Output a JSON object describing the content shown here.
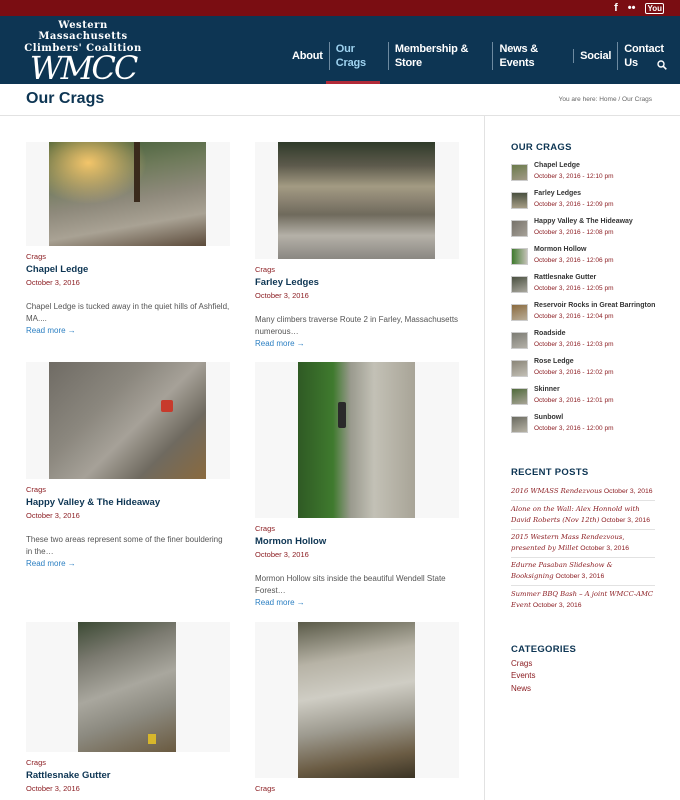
{
  "social": {
    "facebook": "f",
    "flickr": "••",
    "youtube": "You"
  },
  "logo": {
    "line1": "Western Massachusetts",
    "line2": "Climbers' Coalition",
    "wordmark": "WMCC"
  },
  "nav": {
    "items": [
      {
        "label": "About"
      },
      {
        "label": "Our Crags",
        "active": true
      },
      {
        "label": "Membership & Store"
      },
      {
        "label": "News & Events"
      },
      {
        "label": "Social"
      },
      {
        "label": "Contact Us"
      }
    ]
  },
  "page": {
    "title": "Our Crags",
    "breadcrumb": {
      "prefix": "You are here:",
      "home": "Home",
      "sep": "/",
      "current": "Our Crags"
    }
  },
  "posts": [
    {
      "category": "Crags",
      "title": "Chapel Ledge",
      "date": "October 3, 2016",
      "excerpt": "Chapel Ledge is tucked away in the quiet hills of Ashfield, MA....",
      "more": "Read more →"
    },
    {
      "category": "Crags",
      "title": "Farley Ledges",
      "date": "October 3, 2016",
      "excerpt": "Many climbers traverse Route 2 in Farley, Massachusetts numerous…",
      "more": "Read more →"
    },
    {
      "category": "Crags",
      "title": "Happy Valley & The Hideaway",
      "date": "October 3, 2016",
      "excerpt": "These two areas represent some of the finer bouldering in the…",
      "more": "Read more →"
    },
    {
      "category": "Crags",
      "title": "Mormon Hollow",
      "date": "October 3, 2016",
      "excerpt": "Mormon Hollow sits inside the beautiful Wendell State Forest…",
      "more": "Read more →"
    },
    {
      "category": "Crags",
      "title": "Rattlesnake Gutter",
      "date": "October 3, 2016"
    },
    {
      "category": "Crags"
    }
  ],
  "sidebar": {
    "crags_heading": "OUR CRAGS",
    "crags": [
      {
        "name": "Chapel Ledge",
        "date": "October 3, 2016 - 12:10 pm"
      },
      {
        "name": "Farley Ledges",
        "date": "October 3, 2016 - 12:09 pm"
      },
      {
        "name": "Happy Valley & The Hideaway",
        "date": "October 3, 2016 - 12:08 pm"
      },
      {
        "name": "Mormon Hollow",
        "date": "October 3, 2016 - 12:06 pm"
      },
      {
        "name": "Rattlesnake Gutter",
        "date": "October 3, 2016 - 12:05 pm"
      },
      {
        "name": "Reservoir Rocks in Great Barrington",
        "date": "October 3, 2016 - 12:04 pm"
      },
      {
        "name": "Roadside",
        "date": "October 3, 2016 - 12:03 pm"
      },
      {
        "name": "Rose Ledge",
        "date": "October 3, 2016 - 12:02 pm"
      },
      {
        "name": "Skinner",
        "date": "October 3, 2016 - 12:01 pm"
      },
      {
        "name": "Sunbowl",
        "date": "October 3, 2016 - 12:00 pm"
      }
    ],
    "recent_heading": "RECENT POSTS",
    "recent": [
      {
        "title": "2016 WMASS Rendezvous",
        "date": "October 3, 2016"
      },
      {
        "title": "Alone on the Wall: Alex Honnold with David Roberts (Nov 12th)",
        "date": "October 3, 2016"
      },
      {
        "title": "2015 Western Mass Rendezvous, presented by Millet",
        "date": "October 3, 2016"
      },
      {
        "title": "Edurne Pasaban Slideshow & Booksigning",
        "date": "October 3, 2016"
      },
      {
        "title": "Summer BBQ Bash – A joint WMCC-AMC Event",
        "date": "October 3, 2016"
      }
    ],
    "categories_heading": "CATEGORIES",
    "categories": [
      "Crags",
      "Events",
      "News"
    ]
  }
}
